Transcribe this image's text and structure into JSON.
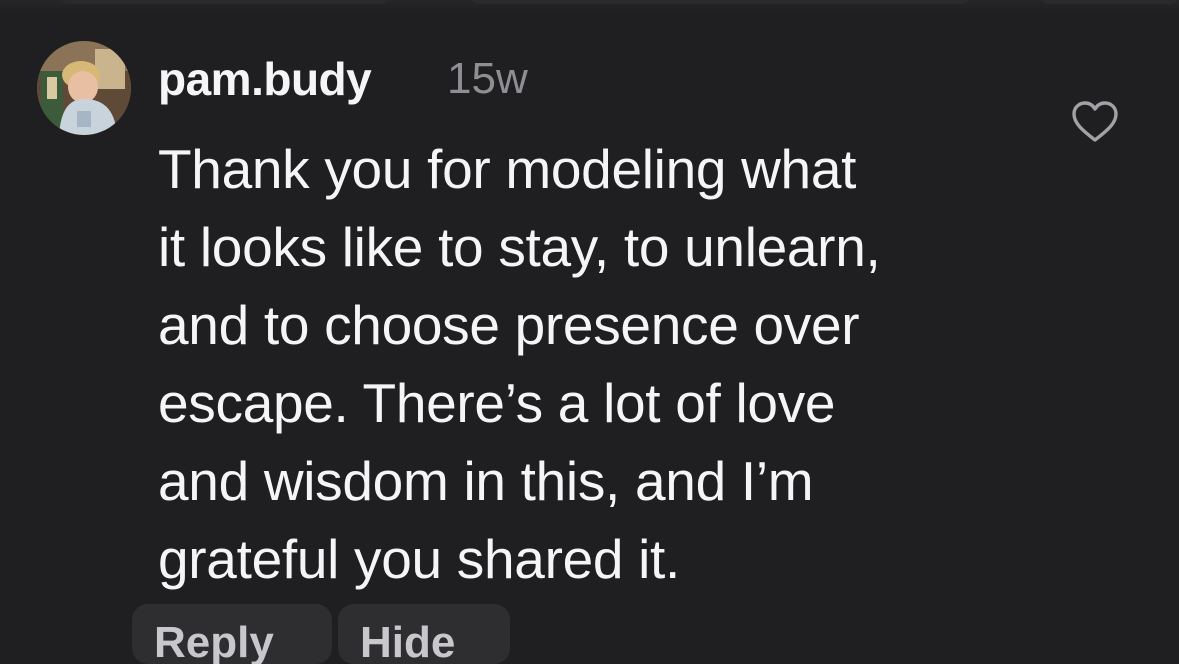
{
  "comment": {
    "username": "pam.budy",
    "timestamp": "15w",
    "text": "Thank you for modeling what\nit looks like to stay, to unlearn,\nand to choose presence over\nescape. There’s a lot of love\nand wisdom in this, and I’m\ngrateful you shared it."
  },
  "actions": {
    "reply_label": "Reply",
    "hide_label": "Hide"
  },
  "icons": {
    "like": "heart-outline-icon",
    "avatar": "profile-photo"
  },
  "colors": {
    "background": "#1f1f21",
    "text_primary": "#f5f5f7",
    "text_secondary": "#8e8e93",
    "button_background": "#2e2e31"
  }
}
